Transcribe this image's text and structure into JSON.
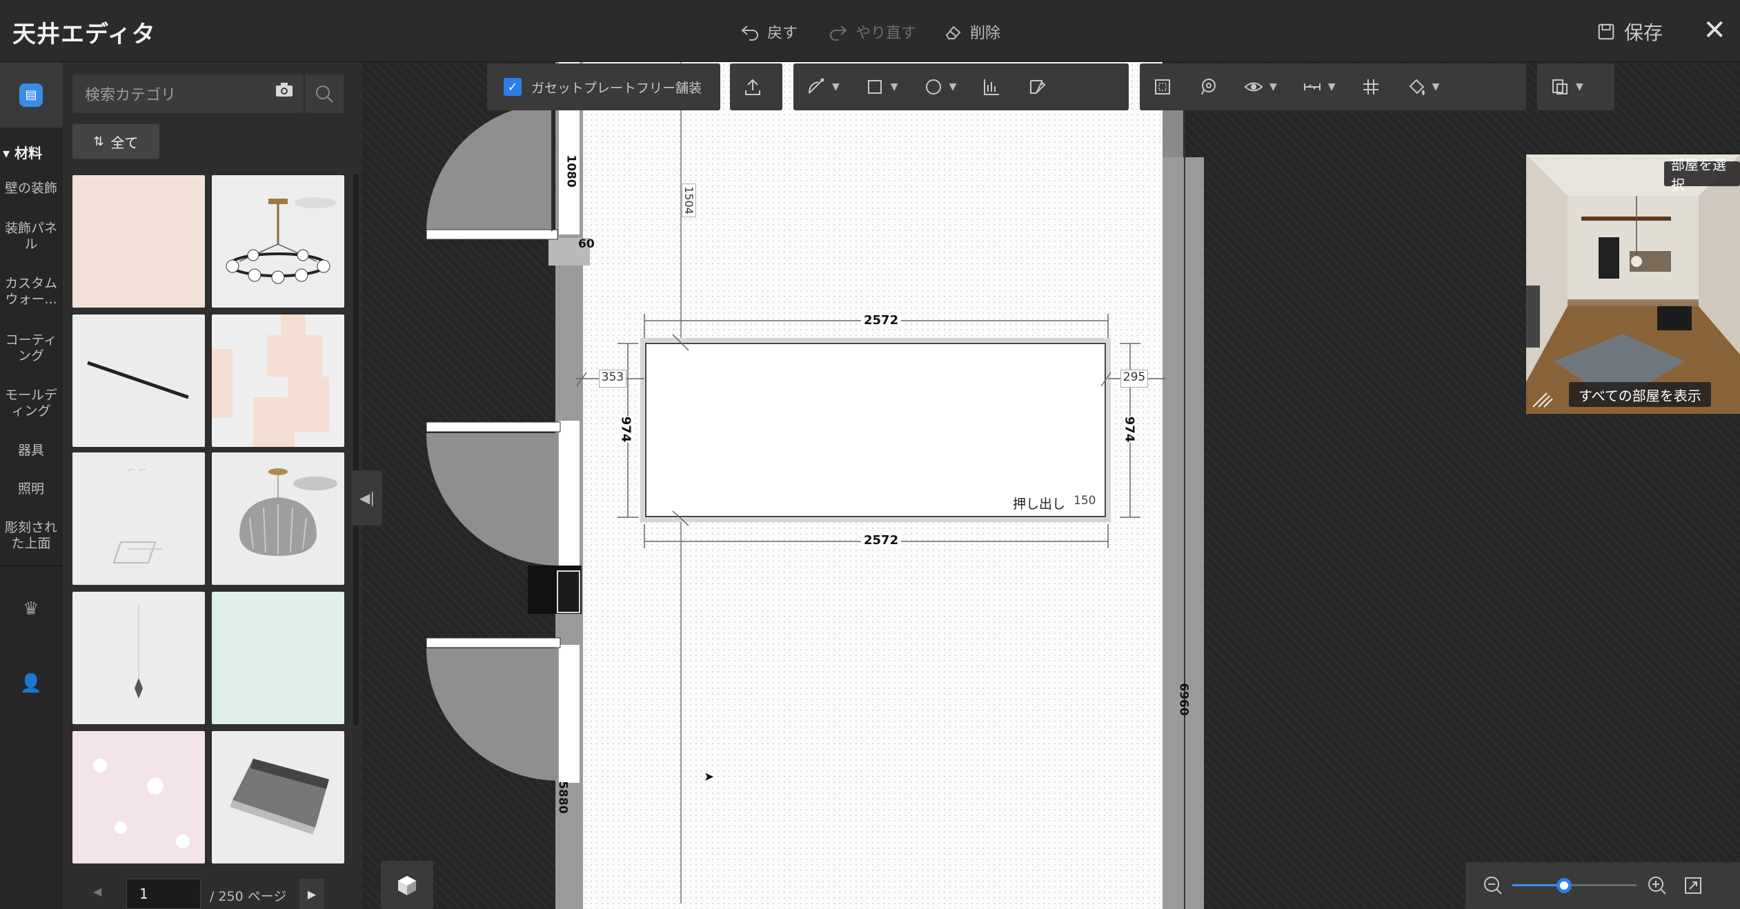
{
  "app": {
    "title": "天井エディタ"
  },
  "header": {
    "undo_label": "戻す",
    "redo_label": "やり直す",
    "delete_label": "削除",
    "save_label": "保存",
    "close_glyph": "✕"
  },
  "rail": {
    "section_title": "▾ 材料",
    "categories": [
      "壁の装飾",
      "装飾パネル",
      "カスタムウォー...",
      "コーティング",
      "モールディング",
      "器具",
      "照明",
      "彫刻された上面"
    ]
  },
  "catalog": {
    "search_placeholder": "検索カテゴリ",
    "filter_label": "全て",
    "pager": {
      "current_page": "1",
      "total_label": "/ 250 ページ"
    }
  },
  "toolbar": {
    "cassette_label": "ガセットプレートフリー舗装",
    "cassette_checked": true
  },
  "plan": {
    "dim_top_width": "2572",
    "dim_bottom_width": "2572",
    "dim_left_height": "974",
    "dim_right_height": "974",
    "dim_left_offset": "353",
    "dim_right_offset": "295",
    "dim_vertical_line": "1504",
    "dim_door_height": "1080",
    "dim_small": "60",
    "dim_right_wall": "6960",
    "dim_left_wall": "5880",
    "extrude_label": "押し出し",
    "extrude_value": "150"
  },
  "minimap": {
    "room_select_label": "部屋を選択",
    "show_all_rooms_label": "すべての部屋を表示"
  },
  "colors": {
    "accent": "#2d7fe8",
    "panel": "#2e2e2e",
    "canvas": "#262626"
  }
}
